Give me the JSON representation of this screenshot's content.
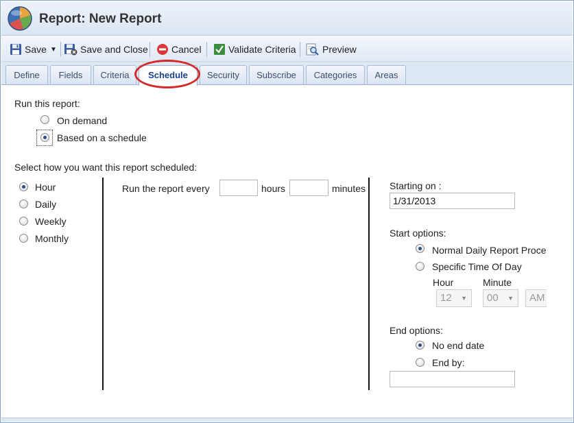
{
  "window": {
    "title": "Report: New Report"
  },
  "toolbar": {
    "save": "Save",
    "save_and_close": "Save and Close",
    "cancel": "Cancel",
    "validate": "Validate Criteria",
    "preview": "Preview"
  },
  "tabs": [
    {
      "label": "Define"
    },
    {
      "label": "Fields"
    },
    {
      "label": "Criteria"
    },
    {
      "label": "Schedule",
      "active": true
    },
    {
      "label": "Security"
    },
    {
      "label": "Subscribe"
    },
    {
      "label": "Categories"
    },
    {
      "label": "Areas"
    }
  ],
  "run": {
    "label": "Run this report:",
    "options": [
      {
        "label": "On demand",
        "selected": false
      },
      {
        "label": "Based on a schedule",
        "selected": true
      }
    ]
  },
  "schedule": {
    "label": "Select how you want this report scheduled:",
    "frequencies": [
      {
        "label": "Hour",
        "selected": true
      },
      {
        "label": "Daily",
        "selected": false
      },
      {
        "label": "Weekly",
        "selected": false
      },
      {
        "label": "Monthly",
        "selected": false
      }
    ],
    "run_every_label": "Run the report every",
    "hours_value": "",
    "hours_label": "hours",
    "minutes_value": "",
    "minutes_label": "minutes"
  },
  "start": {
    "starting_on_label": "Starting on :",
    "starting_on_value": "1/31/2013",
    "options_label": "Start options:",
    "options": [
      {
        "label": "Normal Daily Report Processing",
        "selected": true
      },
      {
        "label": "Specific Time Of Day",
        "selected": false
      }
    ],
    "hour_label": "Hour",
    "minute_label": "Minute",
    "hour_value": "12",
    "minute_value": "00",
    "ampm_value": "AM"
  },
  "end": {
    "options_label": "End options:",
    "options": [
      {
        "label": "No end date",
        "selected": true
      },
      {
        "label": "End by:",
        "selected": false
      }
    ],
    "end_by_value": ""
  },
  "colors": {
    "accent": "#15428b",
    "highlight": "#d42a2a"
  }
}
